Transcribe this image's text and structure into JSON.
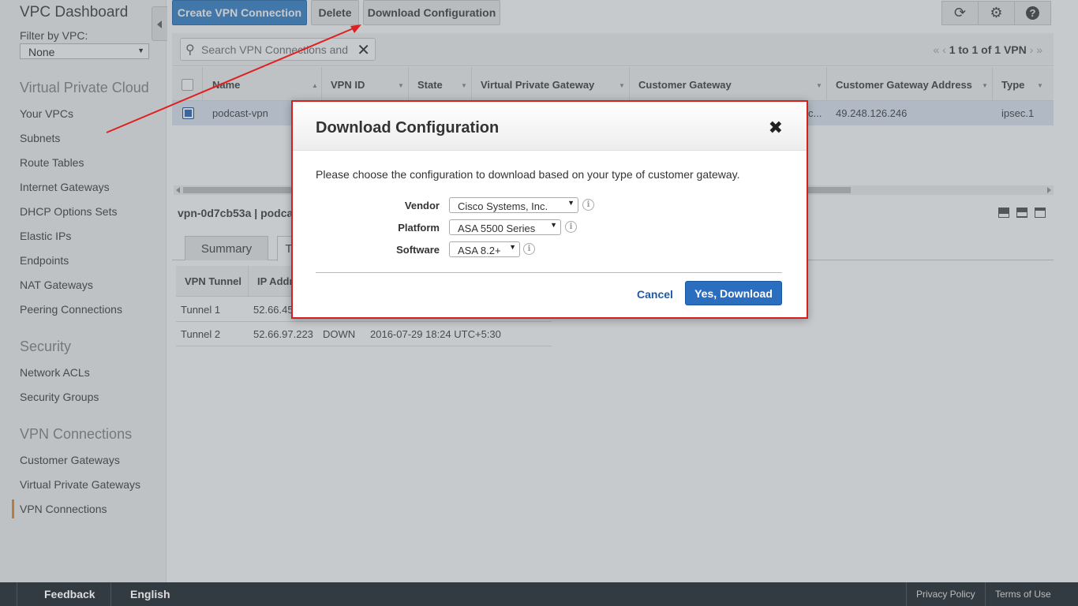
{
  "sidebar": {
    "title": "VPC Dashboard",
    "filter_label": "Filter by VPC:",
    "filter_value": "None",
    "sections": [
      {
        "title": "Virtual Private Cloud",
        "items": [
          "Your VPCs",
          "Subnets",
          "Route Tables",
          "Internet Gateways",
          "DHCP Options Sets",
          "Elastic IPs",
          "Endpoints",
          "NAT Gateways",
          "Peering Connections"
        ]
      },
      {
        "title": "Security",
        "items": [
          "Network ACLs",
          "Security Groups"
        ]
      },
      {
        "title": "VPN Connections",
        "items": [
          "Customer Gateways",
          "Virtual Private Gateways",
          "VPN Connections"
        ]
      }
    ],
    "active_item": "VPN Connections"
  },
  "toolbar": {
    "create_label": "Create VPN Connection",
    "delete_label": "Delete",
    "download_label": "Download Configuration",
    "icons": [
      "refresh-icon",
      "gear-icon",
      "help-icon"
    ]
  },
  "search": {
    "placeholder": "Search VPN Connections and"
  },
  "pager": {
    "text": "1 to 1 of 1 VPN"
  },
  "table": {
    "columns": [
      "Name",
      "VPN ID",
      "State",
      "Virtual Private Gateway",
      "Customer Gateway",
      "Customer Gateway Address",
      "Type"
    ],
    "rows": [
      {
        "name": "podcast-vpn",
        "customer_gateway_tail": "c...",
        "cg_address": "49.248.126.246",
        "type": "ipsec.1"
      }
    ]
  },
  "detail": {
    "title": "vpn-0d7cb53a | podcas",
    "tabs": [
      "Summary",
      "T"
    ],
    "tunnel_columns": [
      "VPN Tunnel",
      "IP Addr"
    ],
    "tunnels": [
      {
        "name": "Tunnel 1",
        "ip": "52.66.45",
        "status": "",
        "changed": ""
      },
      {
        "name": "Tunnel 2",
        "ip": "52.66.97.223",
        "status": "DOWN",
        "changed": "2016-07-29 18:24 UTC+5:30"
      }
    ]
  },
  "modal": {
    "title": "Download Configuration",
    "close_glyph": "✖",
    "description": "Please choose the configuration to download based on your type of customer gateway.",
    "vendor_label": "Vendor",
    "vendor_value": "Cisco Systems, Inc.",
    "platform_label": "Platform",
    "platform_value": "ASA 5500 Series",
    "software_label": "Software",
    "software_value": "ASA 8.2+",
    "cancel_label": "Cancel",
    "confirm_label": "Yes, Download"
  },
  "footer": {
    "feedback": "Feedback",
    "language": "English",
    "privacy": "Privacy Policy",
    "terms": "Terms of Use"
  },
  "colors": {
    "primary": "#2b6dbf",
    "highlight_border": "#d91e1e",
    "active_marker": "#e88c2f",
    "footer_bg": "#333b42"
  }
}
